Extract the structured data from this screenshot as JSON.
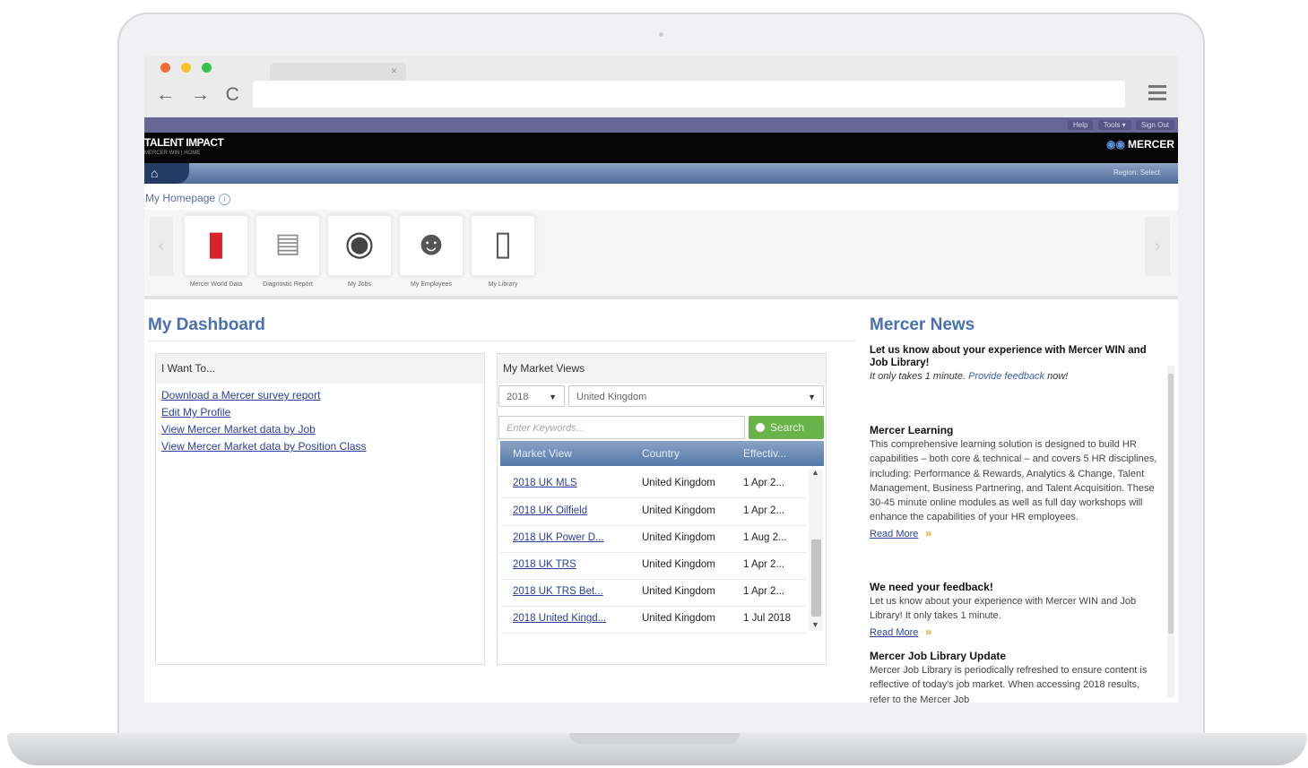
{
  "browser": {
    "tab_close": "×",
    "nav": "← → C"
  },
  "header": {
    "top_links": [
      "Help",
      "Tools ▾",
      "Sign Out"
    ],
    "brand": "TALENT IMPACT",
    "brand_sub": "MERCER WIN | HOME",
    "mercer": "MERCER",
    "region_link": "Region: Select"
  },
  "homepage": {
    "label": "My Homepage",
    "tiles": [
      {
        "label": "Mercer World Data"
      },
      {
        "label": "Diagnostic Report"
      },
      {
        "label": "My Jobs"
      },
      {
        "label": "My Employees"
      },
      {
        "label": "My Library"
      }
    ]
  },
  "dashboard": {
    "title": "My Dashboard",
    "want": {
      "heading": "I Want To...",
      "links": [
        "Download a Mercer survey report",
        "Edit My Profile",
        "View Mercer Market data by Job",
        "View Mercer Market data by Position Class"
      ]
    },
    "market": {
      "heading": "My Market Views",
      "year": "2018",
      "country": "United Kingdom",
      "keyword_placeholder": "Enter Keywords...",
      "search_label": "Search",
      "columns": [
        "Market View",
        "Country",
        "Effectiv..."
      ],
      "rows": [
        {
          "view": "2018 UK MLS",
          "country": "United Kingdom",
          "date": "1 Apr 2..."
        },
        {
          "view": "2018 UK Oilfield",
          "country": "United Kingdom",
          "date": "1 Apr 2..."
        },
        {
          "view": "2018 UK Power D...",
          "country": "United Kingdom",
          "date": "1 Aug 2..."
        },
        {
          "view": "2018 UK TRS",
          "country": "United Kingdom",
          "date": "1 Apr 2..."
        },
        {
          "view": "2018 UK TRS Bet...",
          "country": "United Kingdom",
          "date": "1 Apr 2..."
        },
        {
          "view": "2018 United Kingd...",
          "country": "United Kingdom",
          "date": "1 Jul 2018"
        }
      ]
    }
  },
  "news": {
    "title": "Mercer News",
    "lead": "Let us know about your experience with Mercer WIN and Job Library!",
    "lead_small": "It only takes 1 minute.",
    "lead_link": "Provide feedback",
    "lead_tail": "now!",
    "items": [
      {
        "heading": "Mercer Learning",
        "body": "This comprehensive learning solution is designed to build HR capabilities – both core & technical – and covers 5 HR disciplines, including: Performance & Rewards, Analytics & Change, Talent Management, Business Partnering, and Talent Acquisition. These 30-45 minute online modules as well as full day workshops will enhance the capabilities of your HR employees.",
        "more": "Read More"
      },
      {
        "heading": "We need your feedback!",
        "body": "Let us know about your experience with Mercer WIN and Job Library! It only takes 1 minute.",
        "more": "Read More"
      },
      {
        "heading": "Mercer Job Library Update",
        "body": "Mercer Job Library is periodically refreshed to ensure content is reflective of today's job market. When accessing 2018 results, refer to the Mercer Job",
        "more": ""
      }
    ]
  }
}
